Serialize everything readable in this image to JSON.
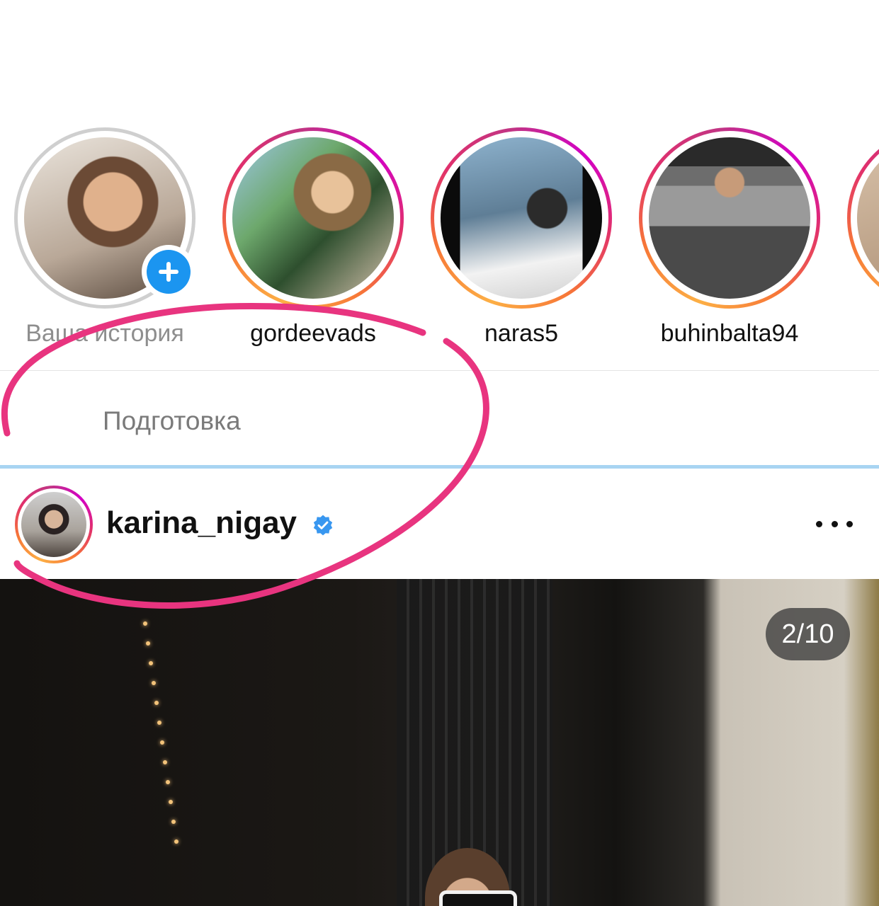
{
  "stories": [
    {
      "username": "Ваша история",
      "own": true,
      "seen": true
    },
    {
      "username": "gordeevads",
      "own": false,
      "seen": false
    },
    {
      "username": "naras5",
      "own": false,
      "seen": false
    },
    {
      "username": "buhinbalta94",
      "own": false,
      "seen": false
    },
    {
      "username": "",
      "own": false,
      "seen": false
    }
  ],
  "upload": {
    "status_text": "Подготовка",
    "progress": 1.0
  },
  "post": {
    "username": "karina_nigay",
    "verified": true,
    "more_icon": "more-horizontal-icon",
    "carousel_counter": "2/10"
  },
  "colors": {
    "accent": "#1b95f0",
    "annotation": "#e8347f",
    "progress": "#a8d4f2"
  }
}
